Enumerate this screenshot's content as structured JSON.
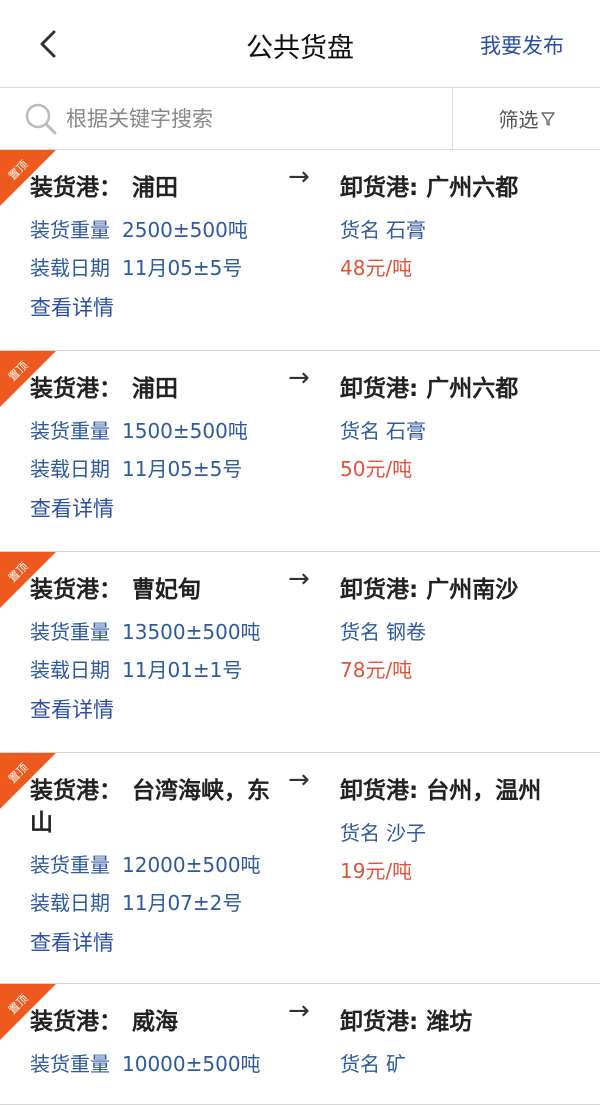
{
  "header": {
    "title": "公共货盘",
    "publish_label": "我要发布"
  },
  "search": {
    "placeholder": "根据关键字搜索",
    "filter_label": "筛选"
  },
  "labels": {
    "load_port": "装货港：",
    "unload_port": "卸货港:",
    "weight": "装货重量",
    "date": "装载日期",
    "goods": "货名",
    "view_details": "查看详情",
    "top_badge": "置顶",
    "arrow": "→"
  },
  "listings": [
    {
      "load_port": "浦田",
      "unload_port": "广州六都",
      "weight": "2500±500吨",
      "date": "11月05±5号",
      "goods": "石膏",
      "price": "48元/吨"
    },
    {
      "load_port": "浦田",
      "unload_port": "广州六都",
      "weight": "1500±500吨",
      "date": "11月05±5号",
      "goods": "石膏",
      "price": "50元/吨"
    },
    {
      "load_port": "曹妃甸",
      "unload_port": "广州南沙",
      "weight": "13500±500吨",
      "date": "11月01±1号",
      "goods": "钢卷",
      "price": "78元/吨"
    },
    {
      "load_port": "台湾海峡，东山",
      "unload_port": "台州，温州",
      "weight": "12000±500吨",
      "date": "11月07±2号",
      "goods": "沙子",
      "price": "19元/吨"
    },
    {
      "load_port": "威海",
      "unload_port": "潍坊",
      "weight": "10000±500吨",
      "date": "",
      "goods": "矿",
      "price": ""
    }
  ],
  "colors": {
    "accent": "#2c4fa3",
    "price": "#e0533a",
    "badge": "#ee5a1e"
  }
}
